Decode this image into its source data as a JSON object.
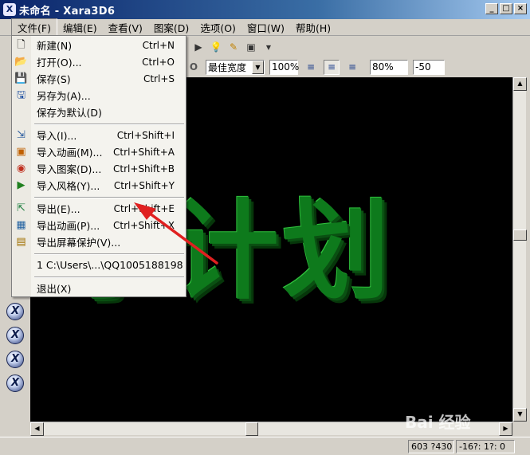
{
  "window": {
    "title": "未命名 - Xara3D6",
    "minimize": "_",
    "maximize": "□",
    "close": "×"
  },
  "menubar": [
    {
      "label": "文件(F)",
      "open": true
    },
    {
      "label": "编辑(E)"
    },
    {
      "label": "查看(V)"
    },
    {
      "label": "图案(D)"
    },
    {
      "label": "选项(O)"
    },
    {
      "label": "窗口(W)"
    },
    {
      "label": "帮助(H)"
    }
  ],
  "file_menu": {
    "items": [
      {
        "label": "新建(N)",
        "shortcut": "Ctrl+N",
        "icon": "new-document-icon",
        "glyph": "🗋"
      },
      {
        "label": "打开(O)...",
        "shortcut": "Ctrl+O",
        "icon": "open-folder-icon",
        "glyph": "📂"
      },
      {
        "label": "保存(S)",
        "shortcut": "Ctrl+S",
        "icon": "save-disk-icon",
        "glyph": "💾"
      },
      {
        "label": "另存为(A)...",
        "shortcut": "",
        "icon": "save-as-icon",
        "glyph": "🖫"
      },
      {
        "label": "保存为默认(D)",
        "shortcut": "",
        "icon": "",
        "glyph": ""
      },
      {
        "label": "导入(I)...",
        "shortcut": "Ctrl+Shift+I",
        "icon": "import-icon",
        "glyph": "⇲"
      },
      {
        "label": "导入动画(M)...",
        "shortcut": "Ctrl+Shift+A",
        "icon": "import-animation-icon",
        "glyph": "▣"
      },
      {
        "label": "导入图案(D)...",
        "shortcut": "Ctrl+Shift+B",
        "icon": "import-design-icon",
        "glyph": "◉"
      },
      {
        "label": "导入风格(Y)...",
        "shortcut": "Ctrl+Shift+Y",
        "icon": "import-style-icon",
        "glyph": "▶"
      },
      {
        "label": "导出(E)...",
        "shortcut": "Ctrl+Shift+E",
        "icon": "export-icon",
        "glyph": "⇱"
      },
      {
        "label": "导出动画(P)...",
        "shortcut": "Ctrl+Shift+X",
        "icon": "export-animation-icon",
        "glyph": "▦"
      },
      {
        "label": "导出屏幕保护(V)...",
        "shortcut": "",
        "icon": "export-screensaver-icon",
        "glyph": "▤"
      },
      {
        "label": "1 C:\\Users\\...\\QQ1005188198",
        "shortcut": "",
        "icon": "",
        "glyph": ""
      },
      {
        "label": "退出(X)",
        "shortcut": "",
        "icon": "",
        "glyph": ""
      }
    ]
  },
  "toolbar": {
    "font_size": "最佳宽度",
    "zoom": "100%",
    "char_width": "80%",
    "depth": "-50"
  },
  "canvas": {
    "text": "享计划",
    "text_color": "#0e7a1c",
    "background": "#000000"
  },
  "status": {
    "size": "603 ?430",
    "angles": "-16?: 1?: 0"
  },
  "watermark": {
    "text": "Bai 经验",
    "paw": "🐾"
  }
}
